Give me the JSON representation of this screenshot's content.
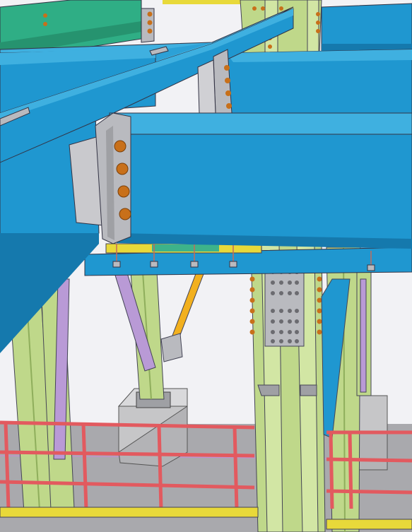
{
  "scene": {
    "kind": "3d-steel-structure-model-view",
    "palette": {
      "beam_blue": "#1f97d0",
      "beam_blue_dark": "#1579ad",
      "beam_blue_light": "#3fb0e0",
      "column_green": "#bfd88a",
      "column_green_dark": "#8fae5c",
      "brace_purple": "#b99ad6",
      "brace_yellow": "#f2b01e",
      "plate_gray": "#b9babf",
      "bolt_orange": "#c8701a",
      "railing_red": "#e25a5f",
      "grating_yellow": "#e8d93a",
      "grating_green": "#3db38a",
      "top_beam_green": "#2fae85",
      "concrete": "#c6c6c8",
      "floor": "#a9a9ad",
      "background": "#f2f2f5"
    },
    "components": [
      "main-beam",
      "cross-beam",
      "column",
      "bracing",
      "end-plate",
      "bolt",
      "base-plate",
      "concrete-pedestal",
      "handrail",
      "grating",
      "gusset-plate"
    ]
  }
}
